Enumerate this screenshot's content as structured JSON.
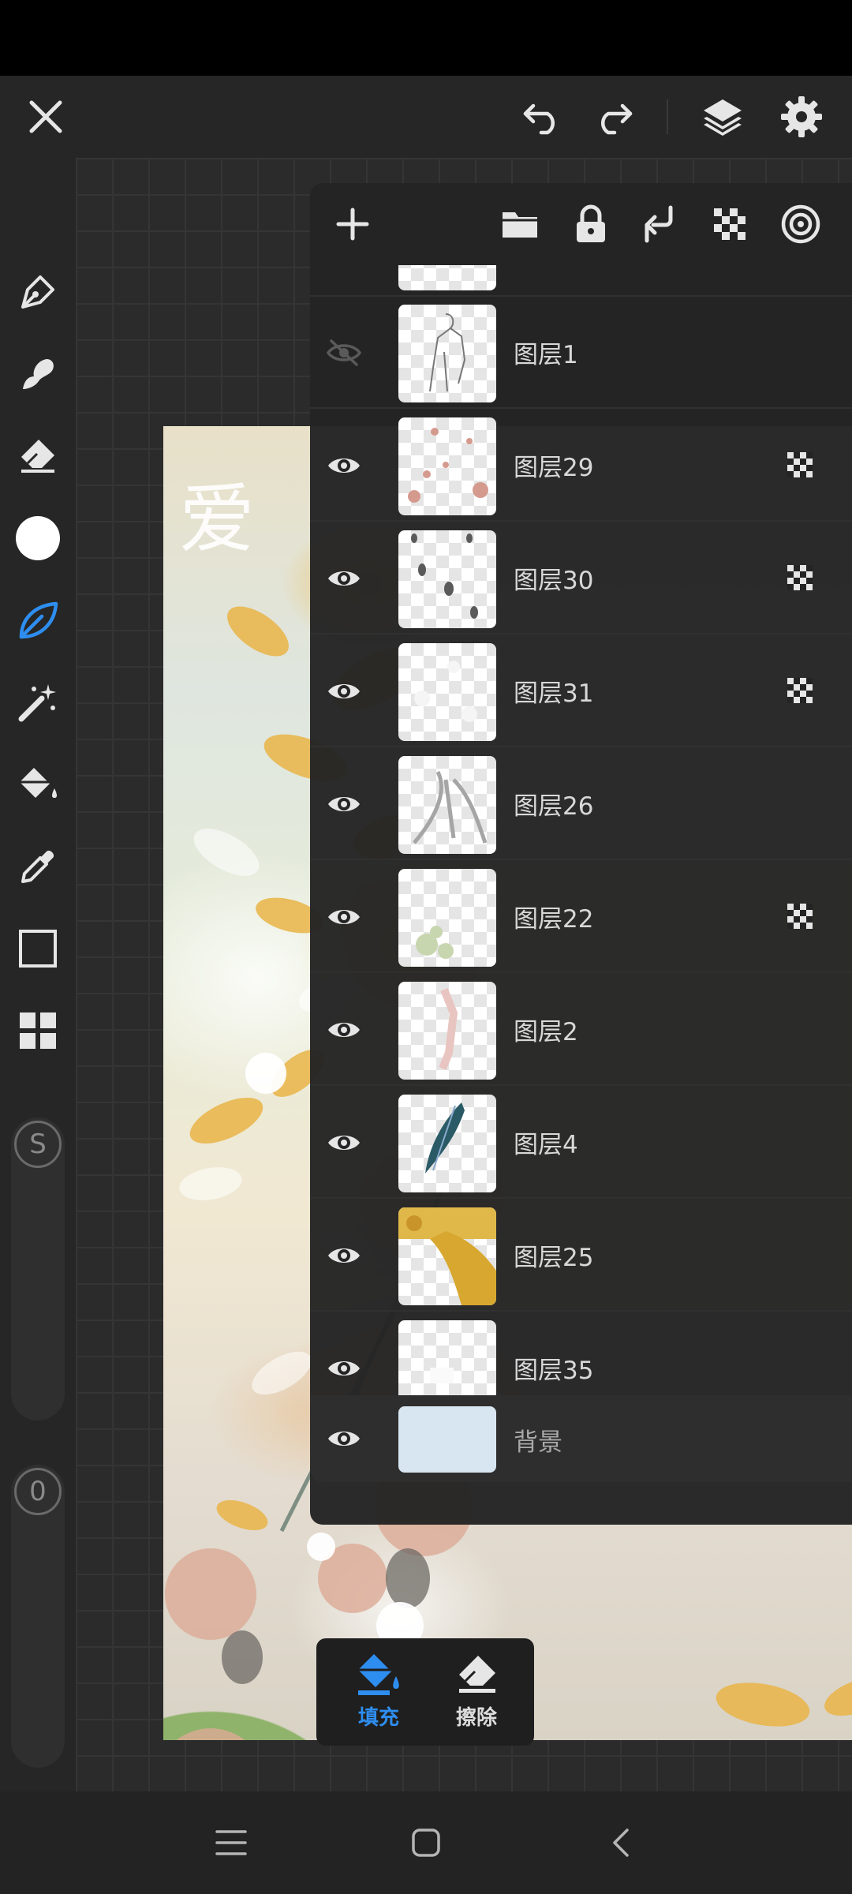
{
  "toolbar": {
    "close_icon": "close-icon",
    "undo_icon": "undo-icon",
    "redo_icon": "redo-icon",
    "layers_icon": "layers-icon",
    "settings_icon": "gear-icon"
  },
  "tools": [
    "pen-icon",
    "smudge-icon",
    "eraser-icon",
    "color-swatch",
    "leaf-brush-icon",
    "magic-wand-icon",
    "fill-bucket-icon",
    "eyedropper-icon",
    "rectangle-select-icon",
    "grid-tools-icon"
  ],
  "sliders": {
    "size_label": "S",
    "opacity_label": "0"
  },
  "artwork": {
    "signature": "爱"
  },
  "layers_panel": {
    "header_icons": [
      "plus-icon",
      "folder-icon",
      "lock-icon",
      "merge-down-icon",
      "alpha-lock-icon",
      "target-icon"
    ],
    "layers": [
      {
        "name": "图层1",
        "visible": false,
        "alpha_locked": false
      },
      {
        "name": "图层29",
        "visible": true,
        "alpha_locked": true
      },
      {
        "name": "图层30",
        "visible": true,
        "alpha_locked": true
      },
      {
        "name": "图层31",
        "visible": true,
        "alpha_locked": true
      },
      {
        "name": "图层26",
        "visible": true,
        "alpha_locked": false
      },
      {
        "name": "图层22",
        "visible": true,
        "alpha_locked": true
      },
      {
        "name": "图层2",
        "visible": true,
        "alpha_locked": false
      },
      {
        "name": "图层4",
        "visible": true,
        "alpha_locked": false
      },
      {
        "name": "图层25",
        "visible": true,
        "alpha_locked": false
      },
      {
        "name": "图层35",
        "visible": true,
        "alpha_locked": false
      }
    ],
    "background_layer": {
      "name": "背景",
      "visible": true
    }
  },
  "fill_mode": {
    "fill_label": "填充",
    "erase_label": "擦除",
    "active": "fill",
    "accent": "#2e8ef0"
  },
  "colors": {
    "accent": "#2e8ef0",
    "icon": "#e6e6e6",
    "panel": "#242424"
  }
}
